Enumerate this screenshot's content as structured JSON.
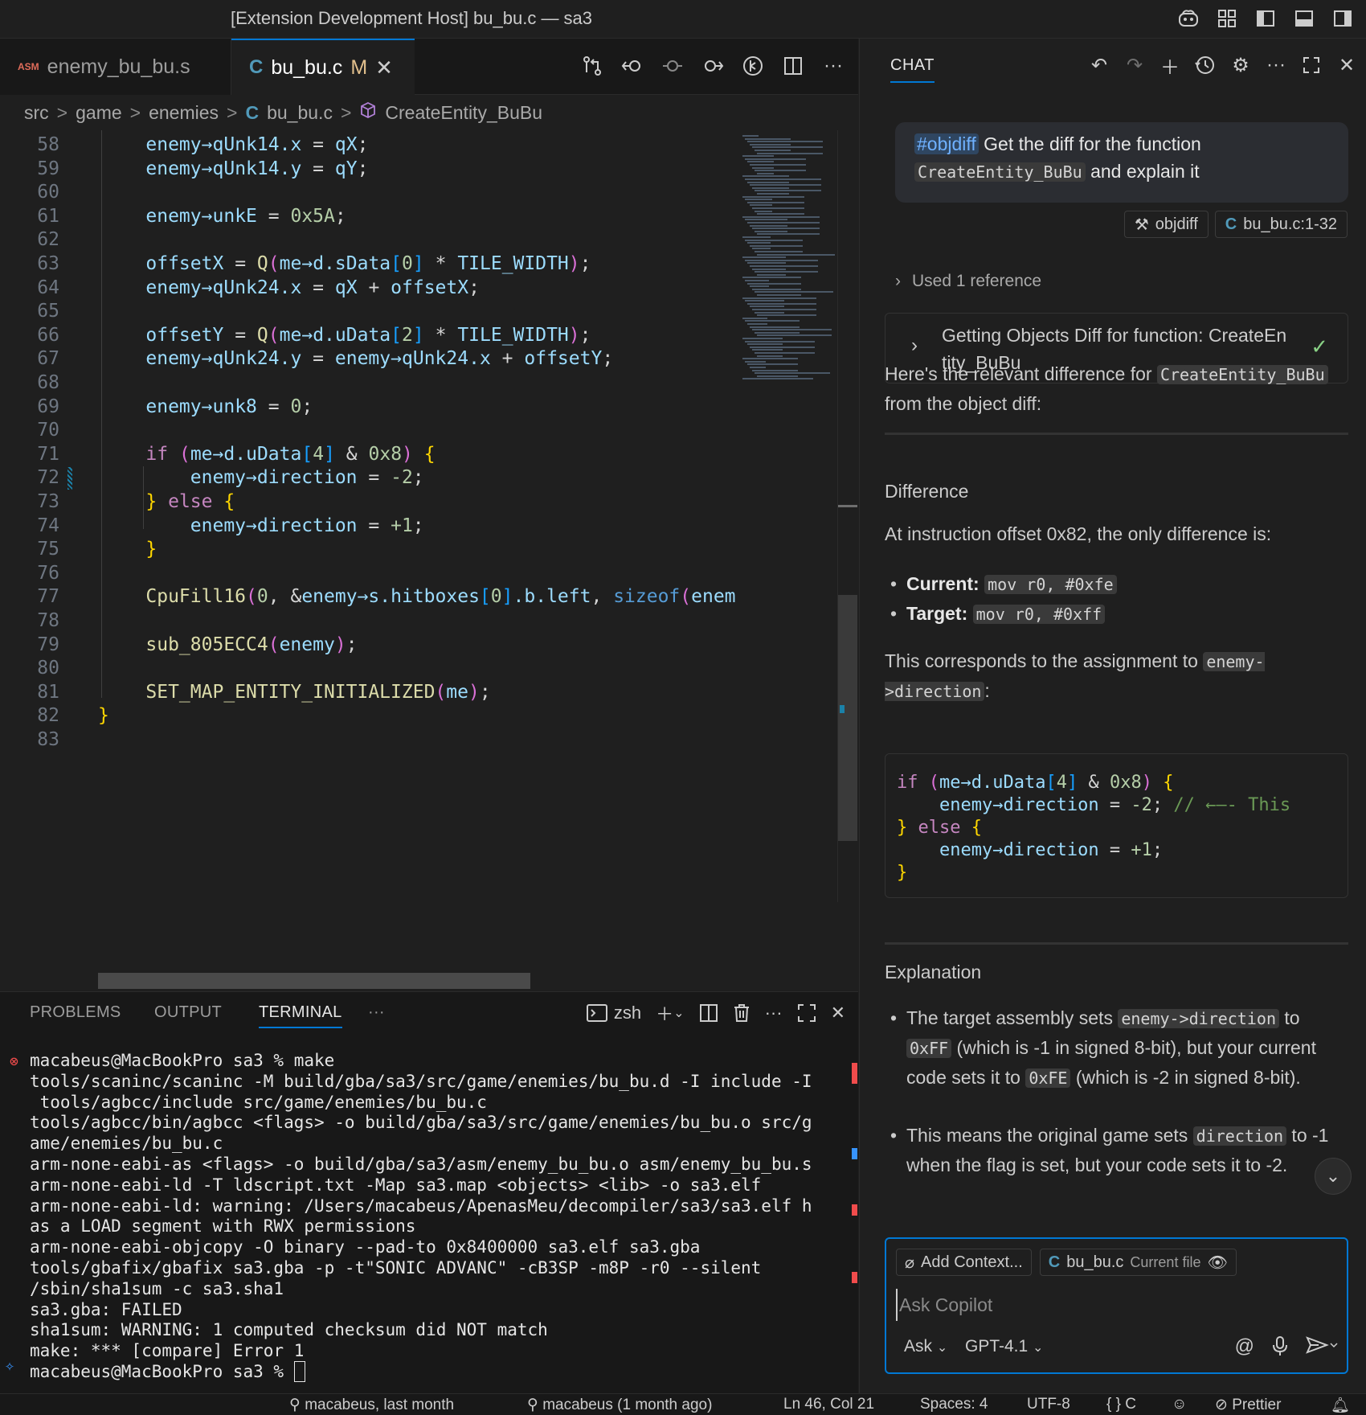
{
  "window": {
    "title": "[Extension Development Host] bu_bu.c — sa3"
  },
  "tabs": [
    {
      "badge": "ASM",
      "label": "enemy_bu_bu.s"
    },
    {
      "badge": "C",
      "label": "bu_bu.c",
      "modified": "M"
    }
  ],
  "breadcrumb": {
    "items": [
      "src",
      "game",
      "enemies",
      "bu_bu.c",
      "CreateEntity_BuBu"
    ],
    "separator": ">"
  },
  "code": {
    "lines": [
      {
        "n": "58",
        "t": "enemy→qUnk14.x = qX;"
      },
      {
        "n": "59",
        "t": "enemy→qUnk14.y = qY;"
      },
      {
        "n": "60",
        "t": ""
      },
      {
        "n": "61",
        "t": "enemy→unkE = 0x5A;"
      },
      {
        "n": "62",
        "t": ""
      },
      {
        "n": "63",
        "t": "offsetX = Q(me→d.sData[0] * TILE_WIDTH);"
      },
      {
        "n": "64",
        "t": "enemy→qUnk24.x = qX + offsetX;"
      },
      {
        "n": "65",
        "t": ""
      },
      {
        "n": "66",
        "t": "offsetY = Q(me→d.uData[2] * TILE_WIDTH);"
      },
      {
        "n": "67",
        "t": "enemy→qUnk24.y = enemy→qUnk24.x + offsetY;"
      },
      {
        "n": "68",
        "t": ""
      },
      {
        "n": "69",
        "t": "enemy→unk8 = 0;"
      },
      {
        "n": "70",
        "t": ""
      },
      {
        "n": "71",
        "t": "if (me→d.uData[4] & 0x8) {"
      },
      {
        "n": "72",
        "t": "    enemy→direction = -2;"
      },
      {
        "n": "73",
        "t": "} else {"
      },
      {
        "n": "74",
        "t": "    enemy→direction = +1;"
      },
      {
        "n": "75",
        "t": "}"
      },
      {
        "n": "76",
        "t": ""
      },
      {
        "n": "77",
        "t": "CpuFill16(0, &enemy→s.hitboxes[0].b.left, sizeof(enem"
      },
      {
        "n": "78",
        "t": ""
      },
      {
        "n": "79",
        "t": "sub_805ECC4(enemy);"
      },
      {
        "n": "80",
        "t": ""
      },
      {
        "n": "81",
        "t": "SET_MAP_ENTITY_INITIALIZED(me);"
      },
      {
        "n": "82",
        "t": "}"
      },
      {
        "n": "83",
        "t": ""
      }
    ]
  },
  "panel": {
    "tabs": [
      "PROBLEMS",
      "OUTPUT",
      "TERMINAL"
    ],
    "active_tab": "TERMINAL",
    "more": "···",
    "shell": "zsh"
  },
  "terminal": {
    "lines": [
      "macabeus@MacBookPro sa3 % make",
      "tools/scaninc/scaninc -M build/gba/sa3/src/game/enemies/bu_bu.d -I include -I",
      " tools/agbcc/include src/game/enemies/bu_bu.c",
      "tools/agbcc/bin/agbcc <flags> -o build/gba/sa3/src/game/enemies/bu_bu.o src/g",
      "ame/enemies/bu_bu.c",
      "arm-none-eabi-as <flags> -o build/gba/sa3/asm/enemy_bu_bu.o asm/enemy_bu_bu.s",
      "arm-none-eabi-ld -T ldscript.txt -Map sa3.map <objects> <lib> -o sa3.elf",
      "arm-none-eabi-ld: warning: /Users/macabeus/ApenasMeu/decompiler/sa3/sa3.elf h",
      "as a LOAD segment with RWX permissions",
      "arm-none-eabi-objcopy -O binary --pad-to 0x8400000 sa3.elf sa3.gba",
      "tools/gbafix/gbafix sa3.gba -p -t\"SONIC ADVANC\" -cB3SP -m8P -r0 --silent",
      "/sbin/sha1sum -c sa3.sha1",
      "sa3.gba: FAILED",
      "sha1sum: WARNING: 1 computed checksum did NOT match",
      "make: *** [compare] Error 1",
      "macabeus@MacBookPro sa3 % "
    ]
  },
  "statusbar": {
    "items": [
      "macabeus, last month",
      "macabeus (1 month ago)",
      "Ln 46, Col 21",
      "Spaces: 4",
      "UTF-8",
      "{ } C",
      "Prettier"
    ]
  },
  "chat": {
    "header": "CHAT",
    "user_message": {
      "tag": "#objdiff",
      "text1": " Get the diff for the function ",
      "code": "CreateEntity_BuBu",
      "text2": " and explain it"
    },
    "attachments": [
      "objdiff",
      "bu_bu.c:1-32"
    ],
    "used_reference": "Used 1 reference",
    "tool_call": "Getting Objects Diff for function: CreateEntity_BuBu",
    "intro_text1": "Here's the relevant difference for ",
    "intro_code": "CreateEntity_BuBu",
    "intro_text2": " from the object diff:",
    "difference_heading": "Difference",
    "offset_text": "At instruction offset 0x82, the only difference is:",
    "current_label": "Current:",
    "current_value": "mov r0, #0xfe",
    "target_label": "Target:",
    "target_value": "mov r0, #0xff",
    "corresponds_text1": "This corresponds to the assignment to ",
    "corresponds_code": "enemy->direction",
    "corresponds_text2": ":",
    "code_block": [
      "if (me→d.uData[4] & 0x8) {",
      "    enemy→direction = -2; // ←—- This",
      "} else {",
      "    enemy→direction = +1;",
      "}"
    ],
    "explanation_heading": "Explanation",
    "bullet1": {
      "t1": "The target assembly sets ",
      "c1": "enemy->direction",
      "t2": " to ",
      "c2": "0xFF",
      "t3": " (which is -1 in signed 8-bit), but your current code sets it to ",
      "c3": "0xFE",
      "t4": " (which is -2 in signed 8-bit)."
    },
    "bullet2": {
      "t1": "This means the original game sets ",
      "c1": "direction",
      "t2": " to -1 when the flag is set, but your code sets it to -2."
    },
    "input": {
      "add_context": "Add Context...",
      "file_chip": "bu_bu.c",
      "file_chip_sub": "Current file",
      "placeholder": "Ask Copilot",
      "mode": "Ask",
      "model": "GPT-4.1"
    }
  }
}
